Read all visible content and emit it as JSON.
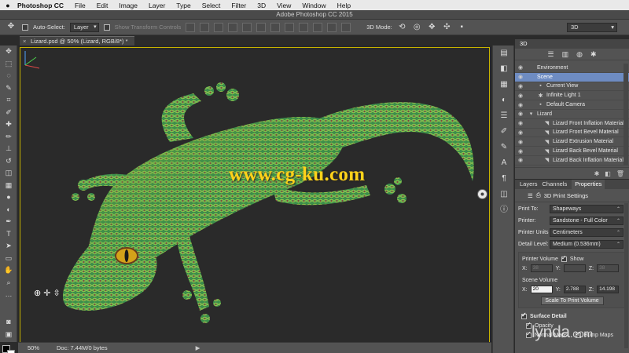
{
  "menubar": {
    "apple": "",
    "app": "Photoshop CC",
    "items": [
      "File",
      "Edit",
      "Image",
      "Layer",
      "Type",
      "Select",
      "Filter",
      "3D",
      "View",
      "Window",
      "Help"
    ]
  },
  "window": {
    "title": "Adobe Photoshop CC 2015"
  },
  "options": {
    "auto_select_label": "Auto-Select:",
    "auto_select_value": "Layer",
    "show_transform": "Show Transform Controls",
    "mode_label": "3D Mode:",
    "workspace": "3D"
  },
  "document": {
    "tab": "Lizard.psd @ 50% (Lizard, RGB/8*) *",
    "close": "×",
    "watermark": "www.cg-ku.com",
    "zoom": "50%",
    "doc_info": "Doc: 7.44M/0 bytes"
  },
  "panel3d": {
    "tab": "3D",
    "rows": [
      {
        "label": "Environment",
        "indent": 0,
        "glyph": ""
      },
      {
        "label": "Scene",
        "indent": 0,
        "glyph": "",
        "selected": true
      },
      {
        "label": "Current View",
        "indent": 1,
        "glyph": "▪"
      },
      {
        "label": "Infinite Light 1",
        "indent": 1,
        "glyph": "✱"
      },
      {
        "label": "Default Camera",
        "indent": 1,
        "glyph": "▪"
      },
      {
        "label": "Lizard",
        "indent": 0,
        "glyph": "▾"
      },
      {
        "label": "Lizard Front Inflation Material",
        "indent": 2,
        "glyph": "◥"
      },
      {
        "label": "Lizard Front Bevel Material",
        "indent": 2,
        "glyph": "◥"
      },
      {
        "label": "Lizard Extrusion Material",
        "indent": 2,
        "glyph": "◥"
      },
      {
        "label": "Lizard Back Bevel Material",
        "indent": 2,
        "glyph": "◥"
      },
      {
        "label": "Lizard Back Inflation Material",
        "indent": 2,
        "glyph": "◥"
      }
    ]
  },
  "properties": {
    "tabs": [
      "Layers",
      "Channels",
      "Properties"
    ],
    "title": "3D Print Settings",
    "print_to_label": "Print To:",
    "print_to": "Shapeways",
    "printer_label": "Printer:",
    "printer": "Sandstone - Full Color",
    "units_label": "Printer Units",
    "units": "Centimeters",
    "detail_label": "Detail Level:",
    "detail": "Medium (0.536mm)",
    "printer_volume_label": "Printer Volume",
    "show_label": "Show",
    "pv_x_label": "X:",
    "pv_x": "38",
    "pv_y_label": "Y:",
    "pv_y": "",
    "pv_z_label": "Z:",
    "pv_z": "38",
    "scene_volume_label": "Scene Volume",
    "sv_x_label": "X:",
    "sv_x": "20",
    "sv_y_label": "Y:",
    "sv_y": "2.788",
    "sv_z_label": "Z:",
    "sv_z": "14.198",
    "scale_button": "Scale To Print Volume",
    "surface_detail": "Surface Detail",
    "opacity": "Opacity",
    "normal_maps": "Normal Maps",
    "bump_maps": "Bump Maps"
  },
  "branding": {
    "name": "lynda",
    "suffix": ".com"
  },
  "colors": {
    "canvas_border": "#c8b400",
    "selection": "#6e8cc2",
    "watermark": "#ffd21a"
  }
}
